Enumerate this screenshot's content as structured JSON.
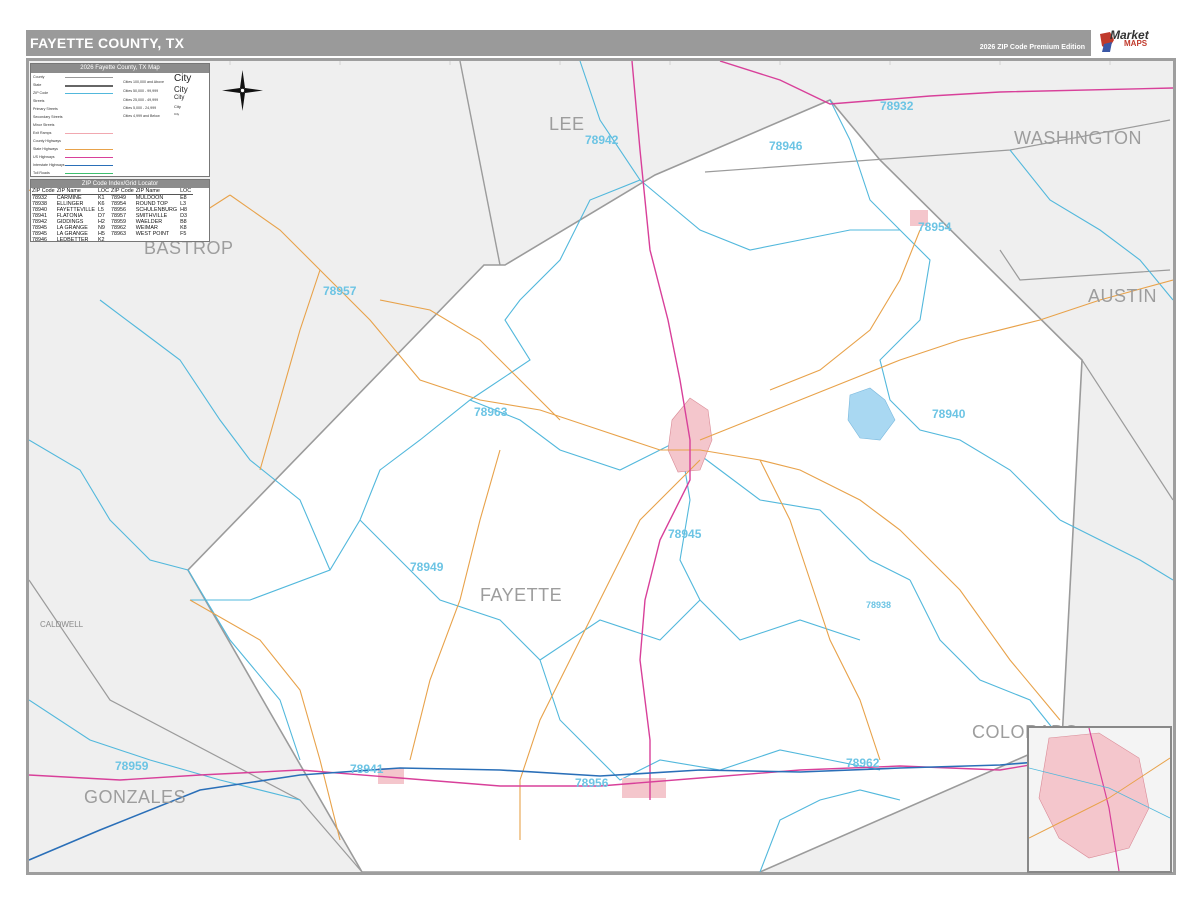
{
  "header": {
    "title": "FAYETTE COUNTY, TX",
    "edition": "2026 ZIP Code Premium Edition"
  },
  "logo": {
    "brand_line1": "Market",
    "brand_line2": "MAPS"
  },
  "legend": {
    "title": "2026 Fayette County, TX Map",
    "rows": [
      "County",
      "State",
      "ZIP Code",
      "Streets",
      "Primary Streets",
      "Secondary Streets",
      "Minor Streets",
      "Exit Ramps",
      "County Highways",
      "State Highways",
      "US Highways",
      "Interstate Highways",
      "Toll Roads"
    ],
    "city_sizes": [
      "Cities 100,000 and Above",
      "Cities 50,000 - 99,999",
      "Cities 25,000 - 49,999",
      "Cities 5,000 - 24,999",
      "Cities 4,999 and Below"
    ],
    "city_samples": [
      "City",
      "City",
      "City",
      "City",
      "City"
    ]
  },
  "zip_index": {
    "title": "ZIP Code Index/Grid Locator",
    "headers": [
      "ZIP Code",
      "ZIP Name",
      "LOC",
      "ZIP Code",
      "ZIP Name",
      "LOC"
    ],
    "rows": [
      [
        "78932",
        "CARMINE",
        "K1",
        "78949",
        "MULDOON",
        "E8"
      ],
      [
        "78938",
        "ELLINGER",
        "K6",
        "78954",
        "ROUND TOP",
        "L3"
      ],
      [
        "78940",
        "FAYETTEVILLE",
        "L5",
        "78956",
        "SCHULENBURG",
        "H8"
      ],
      [
        "78941",
        "FLATONIA",
        "D7",
        "78957",
        "SMITHVILLE",
        "D3"
      ],
      [
        "78942",
        "GIDDINGS",
        "H2",
        "78959",
        "WAELDER",
        "B8"
      ],
      [
        "78945",
        "LA GRANGE",
        "N9",
        "78962",
        "WEIMAR",
        "K8"
      ],
      [
        "78945",
        "LA GRANGE",
        "H5",
        "78963",
        "WEST POINT",
        "F5"
      ],
      [
        "78946",
        "LEDBETTER",
        "K2",
        "",
        "",
        ""
      ]
    ]
  },
  "map": {
    "counties": [
      "LEE",
      "WASHINGTON",
      "BASTROP",
      "AUSTIN",
      "FAYETTE",
      "CALDWELL",
      "GONZALES",
      "COLORADO"
    ],
    "zips": [
      "78942",
      "78932",
      "78946",
      "78954",
      "78957",
      "78963",
      "78940",
      "78945",
      "78949",
      "78938",
      "78959",
      "78941",
      "78956",
      "78962"
    ],
    "colors": {
      "zip_boundary": "#52b8dc",
      "county_boundary": "#9b9b9b",
      "state_highway": "#e8a24a",
      "us_highway": "#d8409a",
      "interstate": "#2a6fb8",
      "outside_county": "#efefef",
      "urban": "#f4c6cc",
      "water": "#a9d8f2"
    }
  }
}
